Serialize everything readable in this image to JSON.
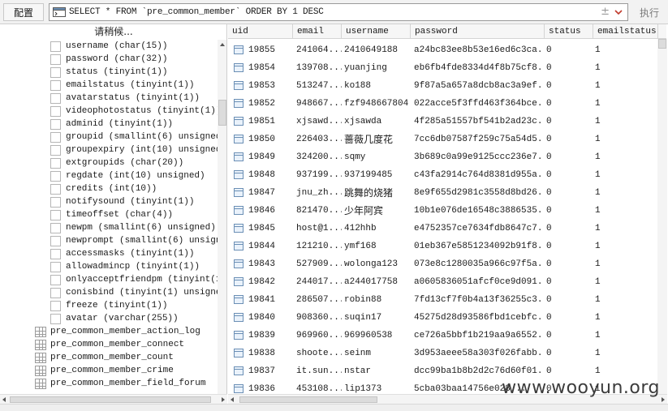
{
  "toolbar": {
    "config_label": "配置",
    "sql_query": "SELECT * FROM `pre_common_member` ORDER BY 1 DESC",
    "plus_label": "±",
    "execute_label": "执行"
  },
  "sidebar": {
    "search_hint": "请稍候...",
    "columns": [
      "username (char(15))",
      "password (char(32))",
      "status (tinyint(1))",
      "emailstatus (tinyint(1))",
      "avatarstatus (tinyint(1))",
      "videophotostatus (tinyint(1))",
      "adminid (tinyint(1))",
      "groupid (smallint(6) unsigned)",
      "groupexpiry (int(10) unsigned)",
      "extgroupids (char(20))",
      "regdate (int(10) unsigned)",
      "credits (int(10))",
      "notifysound (tinyint(1))",
      "timeoffset (char(4))",
      "newpm (smallint(6) unsigned)",
      "newprompt (smallint(6) unsigned)",
      "accessmasks (tinyint(1))",
      "allowadmincp (tinyint(1))",
      "onlyacceptfriendpm (tinyint(1))",
      "conisbind (tinyint(1) unsigned)",
      "freeze (tinyint(1))",
      "avatar (varchar(255))"
    ],
    "tables": [
      "pre_common_member_action_log",
      "pre_common_member_connect",
      "pre_common_member_count",
      "pre_common_member_crime",
      "pre_common_member_field_forum"
    ]
  },
  "grid": {
    "headers": [
      "uid",
      "email",
      "username",
      "password",
      "status",
      "emailstatus"
    ],
    "rows": [
      [
        "19855",
        "241064...",
        "2410649188",
        "a24bc83ee8b53e16ed6c3ca...",
        "0",
        "1"
      ],
      [
        "19854",
        "139708...",
        "yuanjing",
        "eb6fb4fde8334d4f8b75cf8...",
        "0",
        "1"
      ],
      [
        "19853",
        "513247...",
        "ko188",
        "9f87a5a657a8dcb8ac3a9ef...",
        "0",
        "1"
      ],
      [
        "19852",
        "948667...",
        "fzf948667804",
        "022acce5f3ffd463f364bce...",
        "0",
        "1"
      ],
      [
        "19851",
        "xjsawd...",
        "xjsawda",
        "4f285a51557bf541b2ad23c...",
        "0",
        "1"
      ],
      [
        "19850",
        "226403...",
        "蔷薇几度花",
        "7cc6db07587f259c75a54d5...",
        "0",
        "1"
      ],
      [
        "19849",
        "324200...",
        "sqmy",
        "3b689c0a99e9125ccc236e7...",
        "0",
        "1"
      ],
      [
        "19848",
        "937199...",
        "937199485",
        "c43fa2914c764d8381d955a...",
        "0",
        "1"
      ],
      [
        "19847",
        "jnu_zh...",
        "跳舞的烧猪",
        "8e9f655d2981c3558d8bd26...",
        "0",
        "1"
      ],
      [
        "19846",
        "821470...",
        "少年阿宾",
        "10b1e076de16548c3886535...",
        "0",
        "1"
      ],
      [
        "19845",
        "host@1...",
        "412hhb",
        "e4752357ce7634fdb8647c7...",
        "0",
        "1"
      ],
      [
        "19844",
        "121210...",
        "ymf168",
        "01eb367e5851234092b91f8...",
        "0",
        "1"
      ],
      [
        "19843",
        "527909...",
        "wolonga123",
        "073e8c1280035a966c97f5a...",
        "0",
        "1"
      ],
      [
        "19842",
        "244017...",
        "a244017758",
        "a0605836051afcf0ce9d091...",
        "0",
        "1"
      ],
      [
        "19841",
        "286507...",
        "robin88",
        "7fd13cf7f0b4a13f36255c3...",
        "0",
        "1"
      ],
      [
        "19840",
        "908360...",
        "suqin17",
        "45275d28d93586fbd1cebfc...",
        "0",
        "1"
      ],
      [
        "19839",
        "969960...",
        "969960538",
        "ce726a5bbf1b219aa9a6552...",
        "0",
        "1"
      ],
      [
        "19838",
        "shoote...",
        "seinm",
        "3d953aeee58a303f026fabb...",
        "0",
        "1"
      ],
      [
        "19837",
        "it.sun...",
        "nstar",
        "dcc99ba1b8b2d2c76d60f01...",
        "0",
        "1"
      ],
      [
        "19836",
        "453108...",
        "lip1373",
        "5cba03baa14756e028...",
        "0",
        "1"
      ]
    ]
  },
  "watermark": "www.wooyun.org"
}
